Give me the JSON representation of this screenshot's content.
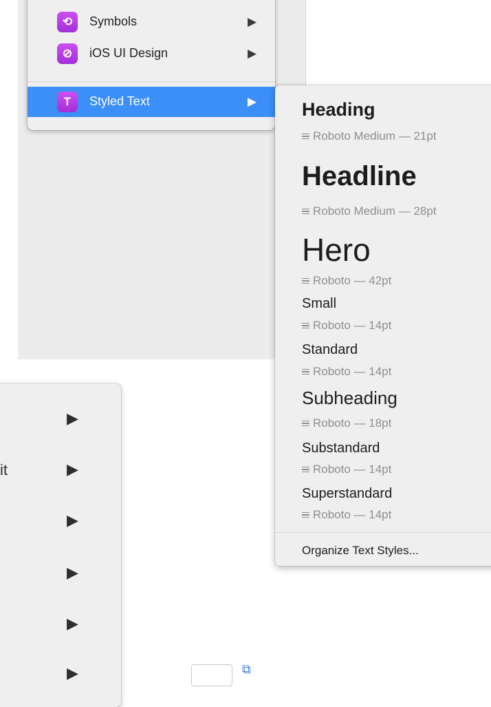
{
  "main_menu": {
    "items": [
      {
        "label": "Symbols",
        "icon": "symbols-icon",
        "glyph": "⟲"
      },
      {
        "label": "iOS UI Design",
        "icon": "link-icon",
        "glyph": "⊘"
      },
      {
        "label": "Styled Text",
        "icon": "text-style-icon",
        "glyph": "T",
        "highlighted": true
      }
    ],
    "arrow": "▶"
  },
  "submenu": {
    "styles": [
      {
        "name": "Heading",
        "meta": "Roboto Medium — 21pt"
      },
      {
        "name": "Headline",
        "meta": "Roboto Medium — 28pt"
      },
      {
        "name": "Hero",
        "meta": "Roboto — 42pt"
      },
      {
        "name": "Small",
        "meta": "Roboto — 14pt"
      },
      {
        "name": "Standard",
        "meta": "Roboto — 14pt"
      },
      {
        "name": "Subheading",
        "meta": "Roboto — 18pt"
      },
      {
        "name": "Substandard",
        "meta": "Roboto — 14pt"
      },
      {
        "name": "Superstandard",
        "meta": "Roboto — 14pt"
      }
    ],
    "organize_label": "Organize Text Styles..."
  },
  "lower_menu": {
    "partial_text": "it",
    "arrow": "▶"
  },
  "bottom_bar": {
    "icon": "copy-edit-icon",
    "glyph": "⧉"
  },
  "colors": {
    "highlight": "#3b8ff6",
    "icon_gradient_top": "#cc4ff0",
    "icon_gradient_bottom": "#a22fd8",
    "meta_text": "#8e8e8e"
  }
}
